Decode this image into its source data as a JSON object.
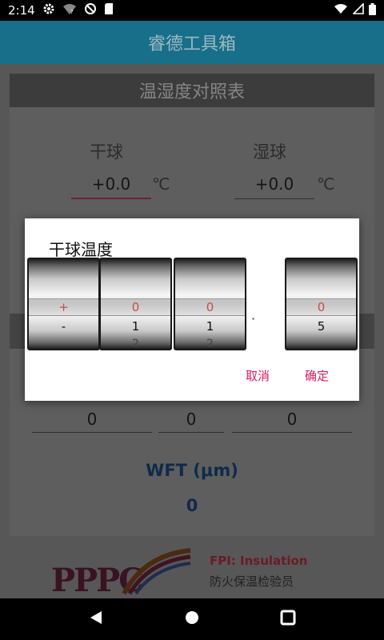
{
  "status_bar": {
    "time": "2:14"
  },
  "app_bar": {
    "title": "睿德工具箱"
  },
  "card": {
    "header": "温湿度对照表",
    "dry_bulb": {
      "label": "干球",
      "value": "+0.0",
      "unit": "℃"
    },
    "wet_bulb": {
      "label": "湿球",
      "value": "+0.0",
      "unit": "℃"
    },
    "results": [
      "0",
      "0",
      "0"
    ],
    "wft": {
      "label": "WFT (μm)",
      "value": "0"
    }
  },
  "banner": {
    "logo_text": "PPPC",
    "line1": "FPI:   Insulation",
    "line2": "防火保温检验员"
  },
  "dialog": {
    "title": "干球温度",
    "wheels": [
      {
        "selected": "+",
        "next": "-",
        "next2": ""
      },
      {
        "selected": "0",
        "next": "1",
        "next2": "2"
      },
      {
        "selected": "0",
        "next": "1",
        "next2": "2"
      },
      {
        "selected": "0",
        "next": "5",
        "next2": ""
      }
    ],
    "separator": "·",
    "cancel": "取消",
    "confirm": "确定"
  },
  "colors": {
    "accent": "#d81b60",
    "app_bar": "#176f8a",
    "selected_digit": "#c44f44"
  }
}
